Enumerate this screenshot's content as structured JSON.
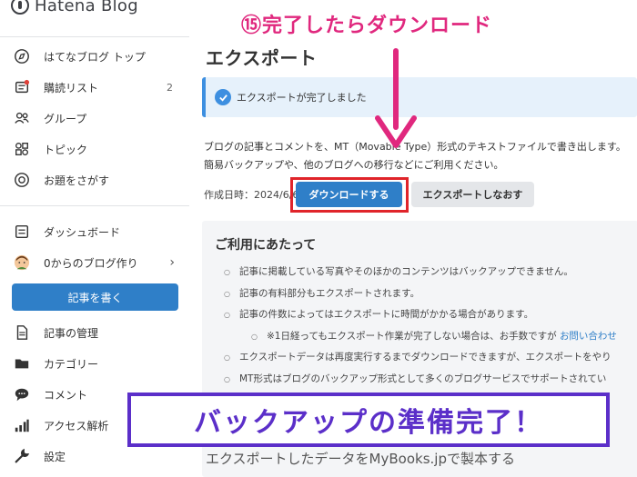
{
  "app": {
    "logo_text": "Hatena Blog"
  },
  "sidebar": {
    "items_top": [
      {
        "label": "はてなブログ トップ",
        "icon": "compass-icon"
      },
      {
        "label": "購読リスト",
        "icon": "subscription-icon",
        "count": "2"
      },
      {
        "label": "グループ",
        "icon": "group-icon"
      },
      {
        "label": "トピック",
        "icon": "topic-icon"
      },
      {
        "label": "お題をさがす",
        "icon": "theme-search-icon"
      }
    ],
    "items_mid": [
      {
        "label": "ダッシュボード",
        "icon": "dashboard-icon"
      },
      {
        "label": "0からのブログ作り",
        "icon": "avatar-icon"
      }
    ],
    "write_button": "記事を書く",
    "items_bottom": [
      {
        "label": "記事の管理",
        "icon": "document-icon"
      },
      {
        "label": "カテゴリー",
        "icon": "folder-icon"
      },
      {
        "label": "コメント",
        "icon": "comment-icon"
      },
      {
        "label": "アクセス解析",
        "icon": "analytics-icon"
      },
      {
        "label": "設定",
        "icon": "wrench-icon"
      }
    ]
  },
  "main": {
    "title": "エクスポート",
    "success_message": "エクスポートが完了しました",
    "description_lines": [
      "ブログの記事とコメントを、MT（Movable Type）形式のテキストファイルで書き出します。",
      "簡易バックアップや、他のブログへの移行などにご利用ください。"
    ],
    "created_at": "作成日時：2024/6/6",
    "download_button": "ダウンロードする",
    "reexport_button": "エクスポートしなおす",
    "notice": {
      "title": "ご利用にあたって",
      "items": [
        "記事に掲載している写真やそのほかのコンテンツはバックアップできません。",
        "記事の有料部分もエクスポートされます。",
        "記事の件数によってはエクスポートに時間がかかる場合があります。"
      ],
      "sub_item_text": "※1日経ってもエクスポート作業が完了しない場合は、お手数ですが ",
      "sub_item_link": "お問い合わせ",
      "items2": [
        "エクスポートデータは再度実行するまでダウンロードできますが、エクスポートをやり",
        "MT形式はブログのバックアップ形式として多くのブログサービスでサポートされてい"
      ]
    },
    "footer_text": "エクスポートしたデータをMyBooks.jpで製本する"
  },
  "annotations": {
    "step_label": "⑮完了したらダウンロード",
    "banner": "バックアップの準備完了！"
  },
  "colors": {
    "accent": "#2f7fc8",
    "annotation_pink": "#e0287e",
    "annotation_red": "#e0242a",
    "banner_purple": "#5b2fc9"
  }
}
